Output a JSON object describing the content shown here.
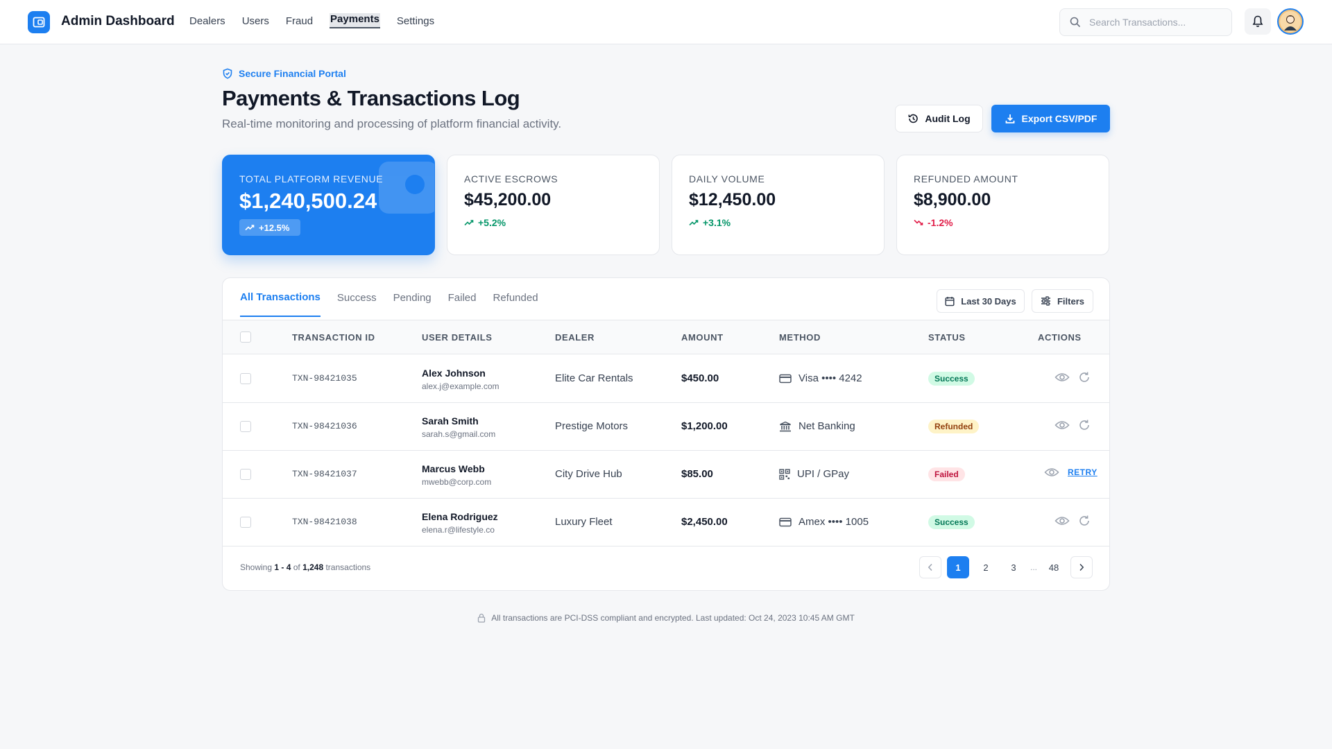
{
  "header": {
    "brand": "Admin Dashboard",
    "nav": [
      "Dealers",
      "Users",
      "Fraud",
      "Payments",
      "Settings"
    ],
    "active_nav": "Payments",
    "search_placeholder": "Search Transactions..."
  },
  "page": {
    "eyebrow": "Secure Financial Portal",
    "title": "Payments & Transactions Log",
    "subtitle": "Real-time monitoring and processing of platform financial activity.",
    "audit_label": "Audit Log",
    "export_label": "Export CSV/PDF"
  },
  "stats": [
    {
      "label": "Total Platform Revenue",
      "value": "$1,240,500.24",
      "change": "+12.5%",
      "trend": "up"
    },
    {
      "label": "Active Escrows",
      "value": "$45,200.00",
      "change": "+5.2%",
      "trend": "up"
    },
    {
      "label": "Daily Volume",
      "value": "$12,450.00",
      "change": "+3.1%",
      "trend": "up"
    },
    {
      "label": "Refunded Amount",
      "value": "$8,900.00",
      "change": "-1.2%",
      "trend": "down"
    }
  ],
  "table": {
    "tabs": [
      "All Transactions",
      "Success",
      "Pending",
      "Failed",
      "Refunded"
    ],
    "active_tab": "All Transactions",
    "date_filter": "Last 30 Days",
    "filters_label": "Filters",
    "columns": [
      "TRANSACTION ID",
      "USER DETAILS",
      "DEALER",
      "AMOUNT",
      "METHOD",
      "STATUS",
      "ACTIONS"
    ],
    "rows": [
      {
        "id": "TXN-98421035",
        "name": "Alex Johnson",
        "email": "alex.j@example.com",
        "dealer": "Elite Car Rentals",
        "amount": "$450.00",
        "method": "Visa •••• 4242",
        "method_icon": "credit-card-icon",
        "status": "Success"
      },
      {
        "id": "TXN-98421036",
        "name": "Sarah Smith",
        "email": "sarah.s@gmail.com",
        "dealer": "Prestige Motors",
        "amount": "$1,200.00",
        "method": "Net Banking",
        "method_icon": "bank-icon",
        "status": "Refunded"
      },
      {
        "id": "TXN-98421037",
        "name": "Marcus Webb",
        "email": "mwebb@corp.com",
        "dealer": "City Drive Hub",
        "amount": "$85.00",
        "method": "UPI / GPay",
        "method_icon": "qr-code-icon",
        "status": "Failed",
        "action_label": "RETRY"
      },
      {
        "id": "TXN-98421038",
        "name": "Elena Rodriguez",
        "email": "elena.r@lifestyle.co",
        "dealer": "Luxury Fleet",
        "amount": "$2,450.00",
        "method": "Amex •••• 1005",
        "method_icon": "credit-card-icon",
        "status": "Success"
      }
    ],
    "footer": {
      "prefix": "Showing",
      "range": "1 - 4",
      "of": "of",
      "total": "1,248",
      "suffix": "transactions"
    },
    "pages": [
      "1",
      "2",
      "3",
      "...",
      "48"
    ],
    "current_page": "1"
  },
  "compliance": "All transactions are PCI-DSS compliant and encrypted. Last updated: Oct 24, 2023 10:45 AM GMT",
  "colors": {
    "accent": "#1d7ff0",
    "success": "#047857",
    "refunded": "#92400e",
    "failed": "#be123c"
  }
}
